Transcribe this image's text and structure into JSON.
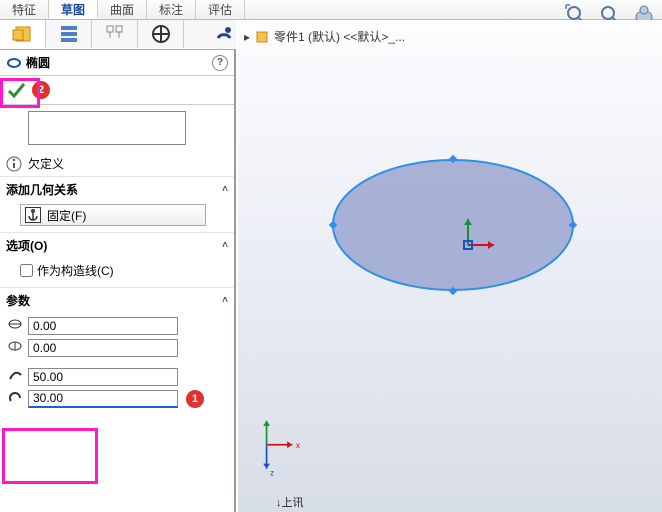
{
  "tabs": {
    "feature": "特征",
    "sketch": "草图",
    "surface": "曲面",
    "annotate": "标注",
    "evaluate": "评估"
  },
  "breadcrumb": {
    "part_label": "零件1 (默认) <<默认>_..."
  },
  "feature": {
    "title": "椭圆",
    "help": "?",
    "status": "欠定义",
    "section_relations": "添加几何关系",
    "fixed_btn": "固定(F)",
    "section_options": "选项(O)",
    "construction_checkbox": "作为构造线(C)",
    "section_params": "参数"
  },
  "params": {
    "cx": "0.00",
    "cy": "0.00",
    "major": "50.00",
    "minor": "30.00"
  },
  "callouts": {
    "one": "1",
    "two": "2"
  },
  "axes": {
    "x": "x",
    "z": "z"
  },
  "footer": {
    "caption": "↓上讯"
  }
}
